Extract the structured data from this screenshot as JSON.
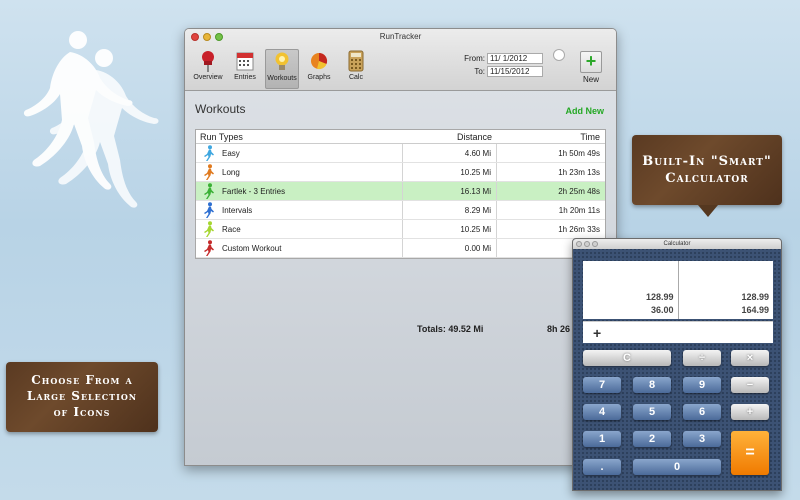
{
  "callouts": {
    "calculator": [
      "Built-In \"Smart\"",
      "Calculator"
    ],
    "icons": [
      "Choose From a",
      "Large Selection",
      "of Icons"
    ]
  },
  "window": {
    "title": "RunTracker",
    "toolbar": [
      {
        "label": "Overview",
        "icon": "pushpin-icon",
        "active": false
      },
      {
        "label": "Entries",
        "icon": "calendar-icon",
        "active": false
      },
      {
        "label": "Workouts",
        "icon": "lightbulb-icon",
        "active": true
      },
      {
        "label": "Graphs",
        "icon": "pie-chart-icon",
        "active": false
      },
      {
        "label": "Calc",
        "icon": "calculator-icon",
        "active": false
      }
    ],
    "from_label": "From:",
    "from_value": "11/ 1/2012",
    "to_label": "To:",
    "to_value": "11/15/2012",
    "new_label": "New"
  },
  "workouts": {
    "title": "Workouts",
    "add_new": "Add New",
    "columns": [
      "Run Types",
      "Distance",
      "Time"
    ],
    "rows": [
      {
        "name": "Easy",
        "distance": "4.60 Mi",
        "time": "1h 50m 49s",
        "color": "#3fa7e0",
        "selected": false
      },
      {
        "name": "Long",
        "distance": "10.25 Mi",
        "time": "1h 23m 13s",
        "color": "#e07a1f",
        "selected": false
      },
      {
        "name": "Fartlek - 3 Entries",
        "distance": "16.13 Mi",
        "time": "2h 25m 48s",
        "color": "#3bb036",
        "selected": true
      },
      {
        "name": "Intervals",
        "distance": "8.29 Mi",
        "time": "1h 20m 11s",
        "color": "#2e6fd1",
        "selected": false
      },
      {
        "name": "Race",
        "distance": "10.25 Mi",
        "time": "1h 26m 33s",
        "color": "#a6d631",
        "selected": false
      },
      {
        "name": "Custom Workout",
        "distance": "0.00 Mi",
        "time": "",
        "color": "#c42a2a",
        "selected": false
      }
    ],
    "totals_distance": "Totals: 49.52 Mi",
    "totals_time": "8h 26"
  },
  "calculator": {
    "title": "Calculator",
    "col1": [
      "128.99",
      "36.00"
    ],
    "col2": [
      "128.99",
      "164.99"
    ],
    "operator": "+",
    "keys": {
      "clear": "C",
      "divide": "÷",
      "multiply": "×",
      "minus": "−",
      "plus": "+",
      "equals": "=",
      "k7": "7",
      "k8": "8",
      "k9": "9",
      "k4": "4",
      "k5": "5",
      "k6": "6",
      "k1": "1",
      "k2": "2",
      "k3": "3",
      "k0": "0",
      "dot": "."
    }
  }
}
